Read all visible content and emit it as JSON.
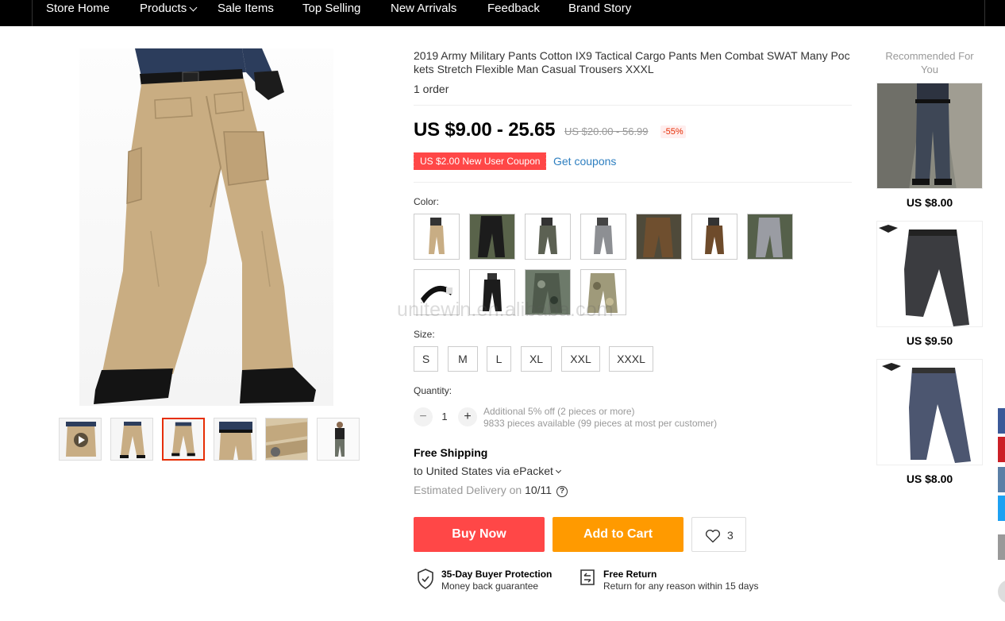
{
  "nav": {
    "items": [
      "Store Home",
      "Products",
      "Sale Items",
      "Top Selling",
      "New Arrivals",
      "Feedback",
      "Brand Story"
    ]
  },
  "product": {
    "title": "2019 Army Military Pants Cotton IX9 Tactical Cargo Pants Men Combat SWAT Many Pockets Stretch Flexible Man Casual Trousers XXXL",
    "orders": "1 order",
    "price": "US $9.00 - 25.65",
    "original_price": "US $20.00 - 56.99",
    "discount": "-55%",
    "coupon": "US $2.00 New User Coupon",
    "get_coupons": "Get coupons",
    "color_label": "Color:",
    "size_label": "Size:",
    "sizes": [
      "S",
      "M",
      "L",
      "XL",
      "XXL",
      "XXXL"
    ],
    "quantity_label": "Quantity:",
    "quantity": "1",
    "qty_minus": "−",
    "qty_plus": "+",
    "qty_note1": "Additional 5% off (2 pieces or more)",
    "qty_note2": "9833 pieces available (99 pieces at most per customer)",
    "shipping_title": "Free Shipping",
    "shipping_to": "to United States via ePacket",
    "delivery_prefix": "Estimated Delivery on",
    "delivery_date": "10/11",
    "help": "?",
    "buy_now": "Buy Now",
    "add_to_cart": "Add to Cart",
    "wishlist_count": "3",
    "protection_title": "35-Day Buyer Protection",
    "protection_sub": "Money back guarantee",
    "return_title": "Free Return",
    "return_sub": "Return for any reason within 15 days",
    "watermark": "unitewin.en.alibaba.com"
  },
  "recommended": {
    "title": "Recommended For You",
    "prices": [
      "US $8.00",
      "US $9.50",
      "US $8.00"
    ]
  },
  "colors": {
    "accent_red": "#ff4747",
    "accent_orange": "#ff9a00",
    "link_blue": "#2e7fc0",
    "khaki": "#c7ab80"
  },
  "swatch_colors": [
    "khaki",
    "black",
    "army-green",
    "grey",
    "brown",
    "brown",
    "grey-camo",
    "belt",
    "black",
    "green-camo",
    "khaki-camo"
  ]
}
